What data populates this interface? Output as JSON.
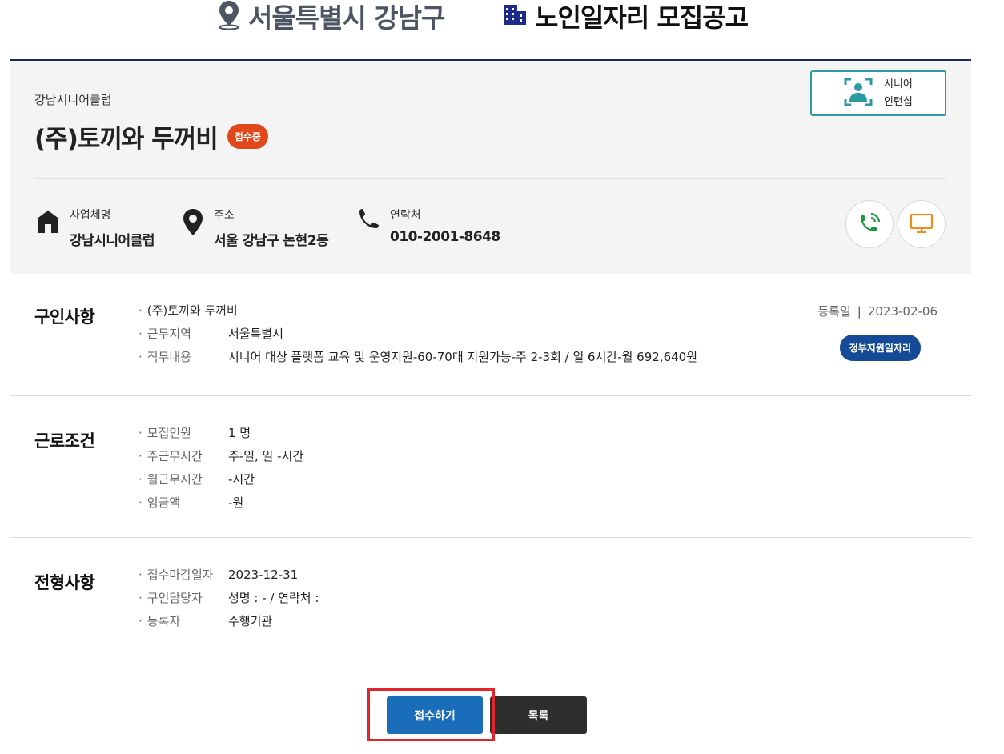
{
  "header": {
    "region": "서울특별시 강남구",
    "page_title": "노인일자리 모집공고"
  },
  "summary": {
    "org_name": "강남시니어클럽",
    "company_name": "(주)토끼와 두꺼비",
    "status_badge": "접수중",
    "program_button": {
      "line1": "시니어",
      "line2": "인턴십"
    },
    "business": {
      "label": "사업체명",
      "value": "강남시니어클럽"
    },
    "address": {
      "label": "주소",
      "value": "서울 강남구 논현2동"
    },
    "contact": {
      "label": "연락처",
      "value": "010-2001-8648"
    }
  },
  "job": {
    "title": "구인사항",
    "company": "(주)토끼와 두꺼비",
    "area_label": "근무지역",
    "area_value": "서울특별시",
    "duty_label": "직무내용",
    "duty_value": "시니어 대상 플랫폼 교육 및 운영지원-60-70대 지원가능-주 2-3회 / 일 6시간-월 692,640원",
    "reg_label": "등록일",
    "reg_date": "2023-02-06",
    "gov_badge": "정부지원일자리"
  },
  "conditions": {
    "title": "근로조건",
    "rows": [
      {
        "k": "모집인원",
        "v": "1 명"
      },
      {
        "k": "주근무시간",
        "v": "주-일, 일 -시간"
      },
      {
        "k": "월근무시간",
        "v": "-시간"
      },
      {
        "k": "임금액",
        "v": "-원"
      }
    ]
  },
  "selection": {
    "title": "전형사항",
    "rows": [
      {
        "k": "접수마감일자",
        "v": "2023-12-31"
      },
      {
        "k": "구인담당자",
        "v": "성명 : - / 연락처 :"
      },
      {
        "k": "등록자",
        "v": "수행기관"
      }
    ]
  },
  "actions": {
    "apply_label": "접수하기",
    "list_label": "목록"
  },
  "colors": {
    "navy": "#1b2a5c",
    "status_orange": "#e0481c",
    "teal": "#2c9aa3",
    "gov_blue": "#154a96",
    "apply_blue": "#1a6db8",
    "phone_green": "#1a9a3a",
    "monitor_orange": "#e8901a",
    "highlight_red": "#e0252b"
  },
  "icons": [
    "location-pin-icon",
    "building-icon",
    "person-frame-icon",
    "house-icon",
    "map-pin-icon",
    "phone-icon",
    "phone-ringing-icon",
    "monitor-icon"
  ]
}
